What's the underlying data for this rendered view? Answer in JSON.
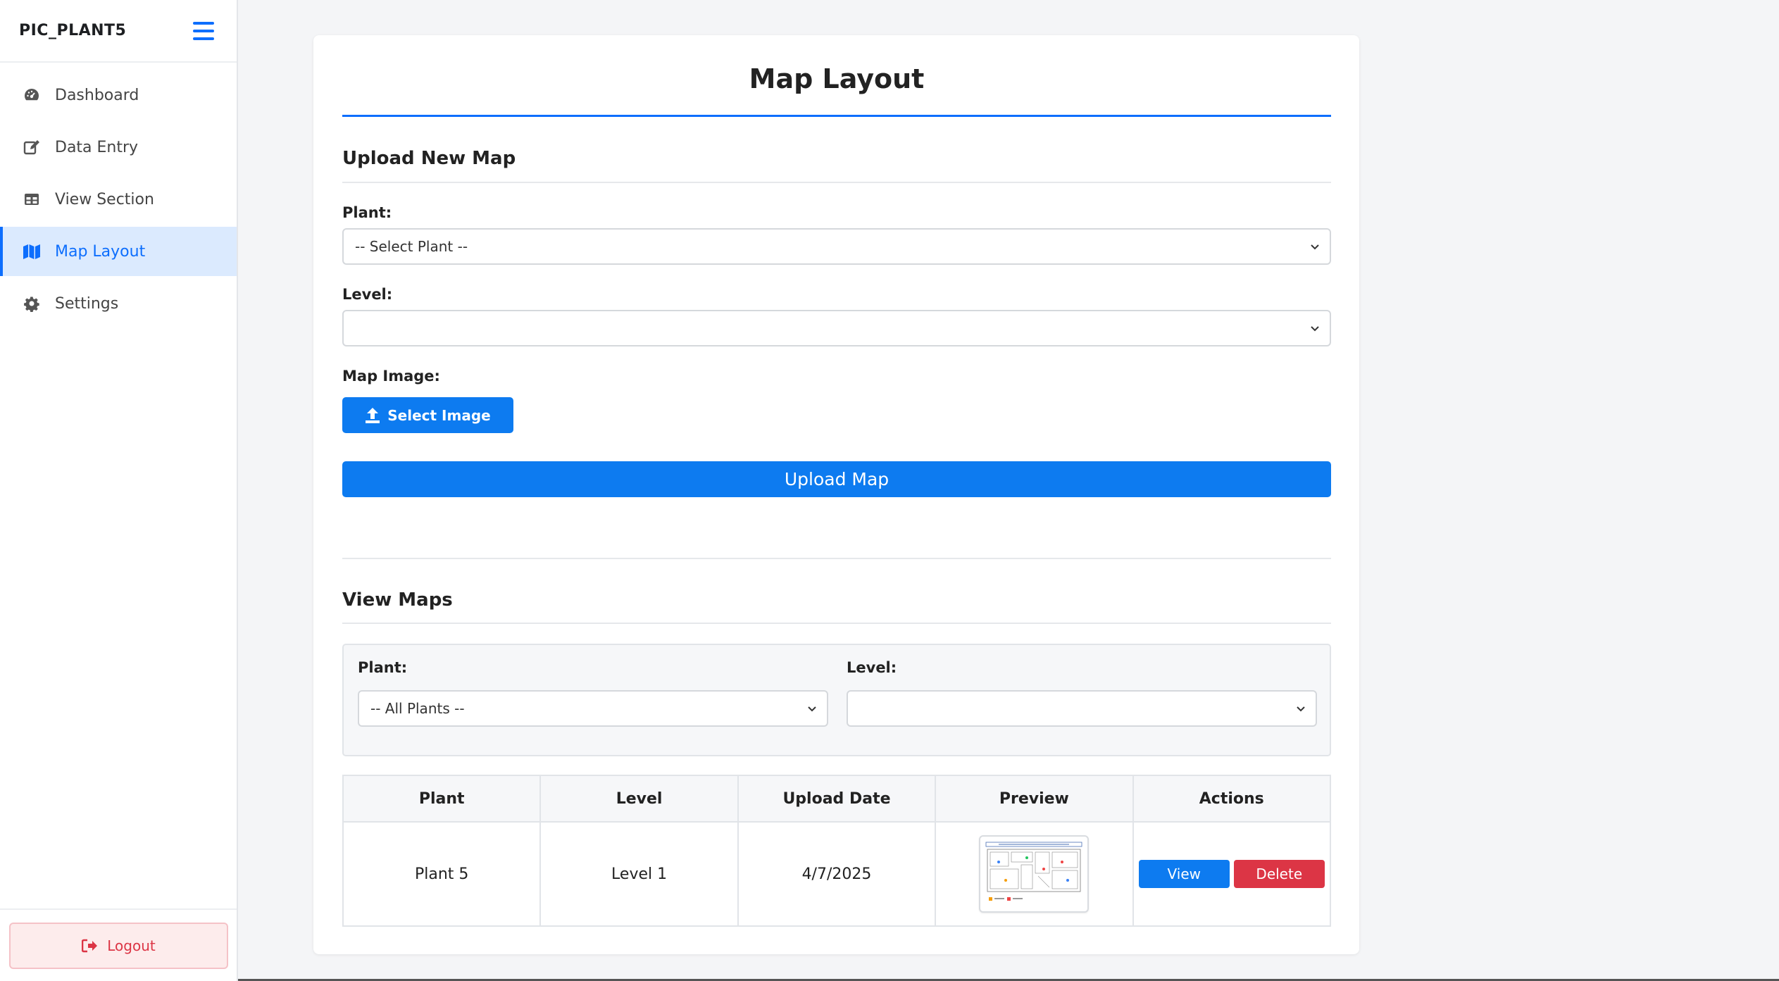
{
  "sidebar": {
    "title": "PIC_PLANT5",
    "items": [
      {
        "label": "Dashboard",
        "icon": "gauge-icon"
      },
      {
        "label": "Data Entry",
        "icon": "edit-icon"
      },
      {
        "label": "View Section",
        "icon": "table-icon"
      },
      {
        "label": "Map Layout",
        "icon": "map-icon",
        "active": true
      },
      {
        "label": "Settings",
        "icon": "gear-icon"
      }
    ],
    "logout_label": "Logout"
  },
  "page": {
    "title": "Map Layout"
  },
  "upload": {
    "section_title": "Upload New Map",
    "plant_label": "Plant:",
    "plant_value": "-- Select Plant --",
    "level_label": "Level:",
    "level_value": "",
    "image_label": "Map Image:",
    "select_image_label": "Select Image",
    "upload_button_label": "Upload Map"
  },
  "view": {
    "section_title": "View Maps",
    "plant_label": "Plant:",
    "plant_value": "-- All Plants --",
    "level_label": "Level:",
    "level_value": "",
    "columns": [
      "Plant",
      "Level",
      "Upload Date",
      "Preview",
      "Actions"
    ],
    "rows": [
      {
        "plant": "Plant 5",
        "level": "Level 1",
        "date": "4/7/2025",
        "view_label": "View",
        "delete_label": "Delete"
      }
    ]
  },
  "colors": {
    "accent": "#0d6efd",
    "primary_button": "#0d7bf0",
    "danger": "#dc3545",
    "active_nav_bg": "#dbeafe"
  }
}
